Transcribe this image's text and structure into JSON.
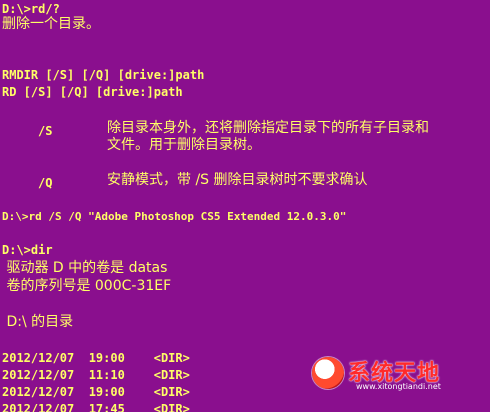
{
  "window": {
    "background_color": "#8a0f8e",
    "text_color": "#ffff66"
  },
  "console": {
    "cmd_help": "D:\\>rd/?",
    "help_desc": "删除一个目录。",
    "syntax_rmdir": "RMDIR [/S] [/Q] [drive:]path",
    "syntax_rd": "RD [/S] [/Q] [drive:]path",
    "opt_s_flag": "/S",
    "opt_s_desc_1": "除目录本身外，还将删除指定目录下的所有子目录和",
    "opt_s_desc_2": "文件。用于删除目录树。",
    "opt_q_flag": "/Q",
    "opt_q_desc": "安静模式，带 /S 删除目录树时不要求确认",
    "cmd_rd": "D:\\>rd /S /Q \"Adobe Photoshop CS5 Extended 12.0.3.0\"",
    "cmd_dir": "D:\\>dir",
    "volume_line": " 驱动器 D 中的卷是 datas",
    "serial_line": " 卷的序列号是 000C-31EF",
    "dir_of": " D:\\ 的目录",
    "dir_rows": [
      {
        "text": "2012/12/07  19:00    <DIR>"
      },
      {
        "text": "2012/12/07  11:10    <DIR>"
      },
      {
        "text": "2012/12/07  19:00    <DIR>"
      },
      {
        "text": "2012/12/07  17:45    <DIR>"
      }
    ]
  },
  "watermark": {
    "title": "系统天地",
    "url": "www.xitongtiandi.net",
    "logo_icon": "globe-logo-icon"
  }
}
